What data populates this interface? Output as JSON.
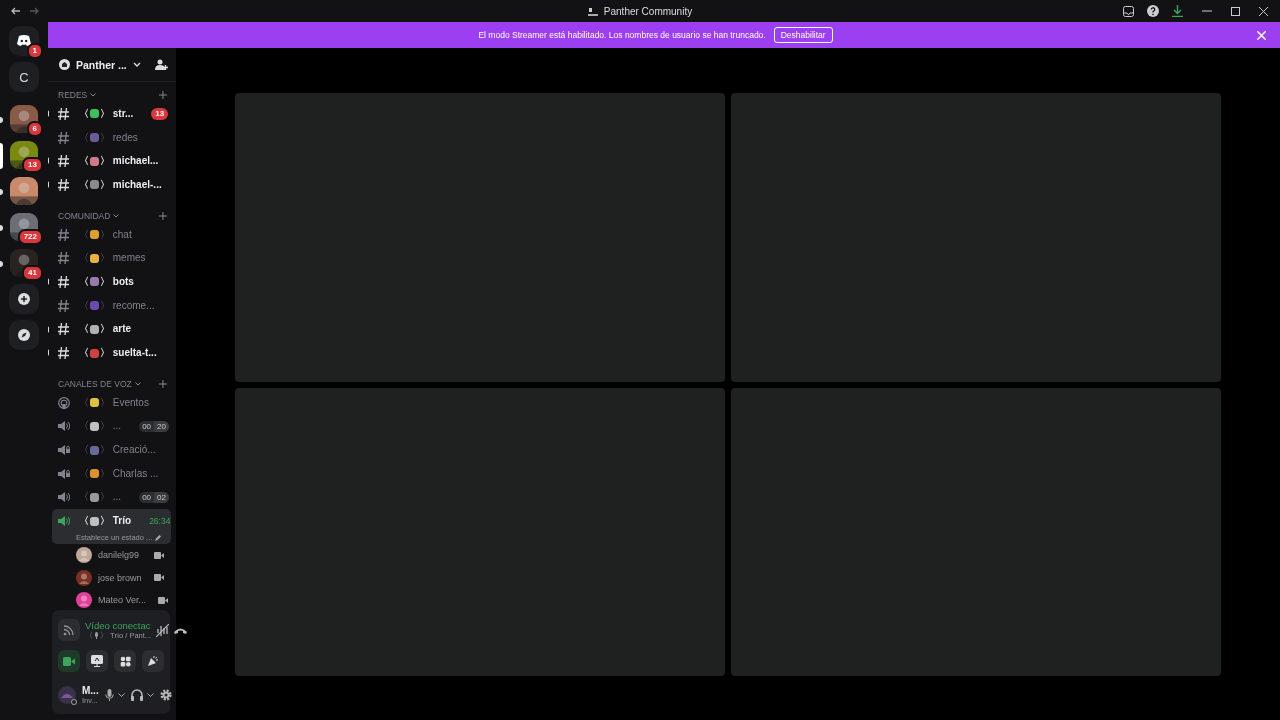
{
  "window": {
    "title": "Panther Community"
  },
  "banner": {
    "text": "El modo Streamer está habilitado. Los nombres de usuario se han truncado.",
    "button": "Deshabilitar"
  },
  "servers": [
    {
      "kind": "home",
      "badge": "1"
    },
    {
      "kind": "letter",
      "label": "C"
    },
    {
      "kind": "avatar",
      "badge": "6",
      "unread": true,
      "selected": false
    },
    {
      "kind": "avatar",
      "badge": "13",
      "unread": false,
      "selected": true
    },
    {
      "kind": "avatar",
      "unread": true,
      "selected": false
    },
    {
      "kind": "avatar",
      "badge": "722",
      "unread": true,
      "selected": false
    },
    {
      "kind": "avatar",
      "badge": "41",
      "unread": true,
      "selected": false
    },
    {
      "kind": "add"
    },
    {
      "kind": "explore"
    }
  ],
  "server_name": "Panther ...",
  "categories": [
    {
      "name": "REDES",
      "channels": [
        {
          "kind": "text",
          "left": "〈",
          "right": "〉",
          "color": "#3fbf5a",
          "name": "str...",
          "unread": true,
          "badge": "13"
        },
        {
          "kind": "text",
          "left": "〈",
          "right": "〉",
          "color": "#6a5a9a",
          "name": "redes",
          "unread": false
        },
        {
          "kind": "text",
          "left": "〈",
          "right": "〉",
          "color": "#d07a8a",
          "name": "michael...",
          "unread": true
        },
        {
          "kind": "text",
          "left": "〈",
          "right": "〉",
          "color": "#8a8a8a",
          "name": "michael-...",
          "unread": true
        }
      ]
    },
    {
      "name": "COMUNIDAD",
      "channels": [
        {
          "kind": "text",
          "left": "〈",
          "right": "〉",
          "color": "#e0a030",
          "name": "chat",
          "unread": false
        },
        {
          "kind": "text",
          "left": "〈",
          "right": "〉",
          "color": "#e8b040",
          "name": "memes",
          "unread": false
        },
        {
          "kind": "text",
          "left": "〈",
          "right": "〉",
          "color": "#9a7ab0",
          "name": "bots",
          "unread": true
        },
        {
          "kind": "text",
          "left": "〈",
          "right": "〉",
          "color": "#6a4ab0",
          "name": "recome...",
          "unread": false
        },
        {
          "kind": "text",
          "left": "〈",
          "right": "〉",
          "color": "#b0b0b0",
          "name": "arte",
          "unread": true
        },
        {
          "kind": "text",
          "left": "〈",
          "right": "〉",
          "color": "#d04040",
          "name": "suelta-t...",
          "unread": true
        }
      ]
    },
    {
      "name": "CANALES DE VOZ",
      "channels": [
        {
          "kind": "stage",
          "left": "〈",
          "right": "〉",
          "color": "#e0c040",
          "name": "Eventos",
          "unread": false
        },
        {
          "kind": "voice",
          "left": "〈",
          "right": "〉",
          "color": "#c0c0c0",
          "name": "...",
          "unread": false,
          "count": "00",
          "limit": "20"
        },
        {
          "kind": "locked",
          "left": "〈",
          "right": "〉",
          "color": "#6a6a9a",
          "name": "Creació...",
          "unread": false
        },
        {
          "kind": "locked",
          "left": "〈",
          "right": "〉",
          "color": "#e09030",
          "name": "Charlas ...",
          "unread": false
        },
        {
          "kind": "voice",
          "left": "〈",
          "right": "〉",
          "color": "#9a9a9a",
          "name": "...",
          "unread": false,
          "count": "00",
          "limit": "02"
        },
        {
          "kind": "active",
          "left": "〈",
          "right": "〉",
          "color": "#c0c0c0",
          "name": "Trío",
          "unread": true,
          "time": "26:34",
          "status": "Establece un estado ...",
          "members": [
            {
              "name": "danilelg99",
              "color": "#c0a898"
            },
            {
              "name": "jose brown",
              "color": "#7a3020"
            },
            {
              "name": "Mateo Ver...",
              "color": "#e0409a"
            }
          ]
        }
      ]
    }
  ],
  "voice_panel": {
    "status": "Vídeo conectac",
    "left": "〈",
    "right": "〉",
    "channel": "Trío / Pant...",
    "camera_on": true
  },
  "user": {
    "name": "M...",
    "status": "Inv..."
  }
}
